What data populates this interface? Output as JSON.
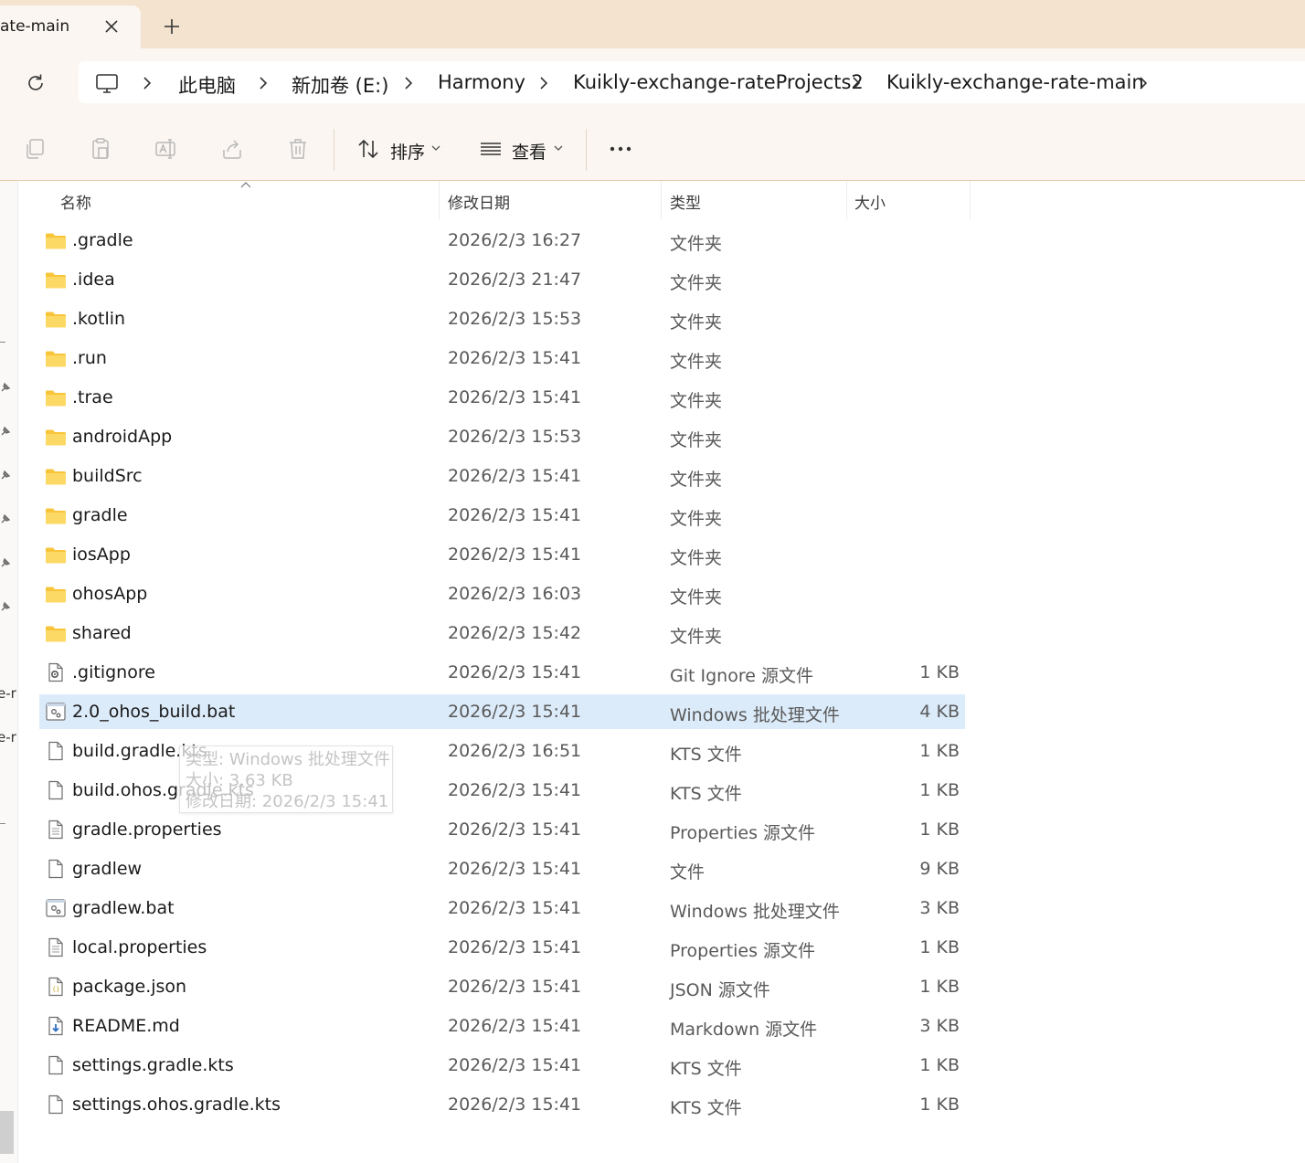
{
  "tab": {
    "title": "ate-main"
  },
  "breadcrumb": [
    "此电脑",
    "新加卷 (E:)",
    "Harmony",
    "Kuikly-exchange-rateProjects2",
    "Kuikly-exchange-rate-main"
  ],
  "toolbar": {
    "sort_label": "排序",
    "view_label": "查看",
    "icons": [
      "copy-icon",
      "paste-icon",
      "rename-icon",
      "share-icon",
      "delete-icon",
      "sort-icon",
      "view-icon",
      "more-icon"
    ]
  },
  "left_pane": {
    "truncated": [
      "e-r",
      "e-r"
    ]
  },
  "columns": {
    "name": "名称",
    "date": "修改日期",
    "type": "类型",
    "size": "大小"
  },
  "files": [
    {
      "name": ".gradle",
      "date": "2026/2/3 16:27",
      "type": "文件夹",
      "size": "",
      "icon": "folder"
    },
    {
      "name": ".idea",
      "date": "2026/2/3 21:47",
      "type": "文件夹",
      "size": "",
      "icon": "folder"
    },
    {
      "name": ".kotlin",
      "date": "2026/2/3 15:53",
      "type": "文件夹",
      "size": "",
      "icon": "folder"
    },
    {
      "name": ".run",
      "date": "2026/2/3 15:41",
      "type": "文件夹",
      "size": "",
      "icon": "folder"
    },
    {
      "name": ".trae",
      "date": "2026/2/3 15:41",
      "type": "文件夹",
      "size": "",
      "icon": "folder"
    },
    {
      "name": "androidApp",
      "date": "2026/2/3 15:53",
      "type": "文件夹",
      "size": "",
      "icon": "folder"
    },
    {
      "name": "buildSrc",
      "date": "2026/2/3 15:41",
      "type": "文件夹",
      "size": "",
      "icon": "folder"
    },
    {
      "name": "gradle",
      "date": "2026/2/3 15:41",
      "type": "文件夹",
      "size": "",
      "icon": "folder"
    },
    {
      "name": "iosApp",
      "date": "2026/2/3 15:41",
      "type": "文件夹",
      "size": "",
      "icon": "folder"
    },
    {
      "name": "ohosApp",
      "date": "2026/2/3 16:03",
      "type": "文件夹",
      "size": "",
      "icon": "folder"
    },
    {
      "name": "shared",
      "date": "2026/2/3 15:42",
      "type": "文件夹",
      "size": "",
      "icon": "folder"
    },
    {
      "name": ".gitignore",
      "date": "2026/2/3 15:41",
      "type": "Git Ignore 源文件",
      "size": "1 KB",
      "icon": "config"
    },
    {
      "name": "2.0_ohos_build.bat",
      "date": "2026/2/3 15:41",
      "type": "Windows 批处理文件",
      "size": "4 KB",
      "icon": "batch",
      "selected": true
    },
    {
      "name": "build.gradle.kts",
      "date": "2026/2/3 16:51",
      "type": "KTS 文件",
      "size": "1 KB",
      "icon": "file"
    },
    {
      "name": "build.ohos.gradle.kts",
      "date": "2026/2/3 15:41",
      "type": "KTS 文件",
      "size": "1 KB",
      "icon": "file"
    },
    {
      "name": "gradle.properties",
      "date": "2026/2/3 15:41",
      "type": "Properties 源文件",
      "size": "1 KB",
      "icon": "text"
    },
    {
      "name": "gradlew",
      "date": "2026/2/3 15:41",
      "type": "文件",
      "size": "9 KB",
      "icon": "file"
    },
    {
      "name": "gradlew.bat",
      "date": "2026/2/3 15:41",
      "type": "Windows 批处理文件",
      "size": "3 KB",
      "icon": "batch"
    },
    {
      "name": "local.properties",
      "date": "2026/2/3 15:41",
      "type": "Properties 源文件",
      "size": "1 KB",
      "icon": "text"
    },
    {
      "name": "package.json",
      "date": "2026/2/3 15:41",
      "type": "JSON 源文件",
      "size": "1 KB",
      "icon": "json"
    },
    {
      "name": "README.md",
      "date": "2026/2/3 15:41",
      "type": "Markdown 源文件",
      "size": "3 KB",
      "icon": "markdown"
    },
    {
      "name": "settings.gradle.kts",
      "date": "2026/2/3 15:41",
      "type": "KTS 文件",
      "size": "1 KB",
      "icon": "file"
    },
    {
      "name": "settings.ohos.gradle.kts",
      "date": "2026/2/3 15:41",
      "type": "KTS 文件",
      "size": "1 KB",
      "icon": "file"
    }
  ],
  "tooltip": {
    "type_line": "类型: Windows 批处理文件",
    "size_line": "大小: 3.63 KB",
    "date_line": "修改日期: 2026/2/3 15:41"
  },
  "colors": {
    "tab_strip": "#f3e3cf",
    "chrome": "#fbf6f1",
    "folder": "#f8c53a",
    "selection": "#dcebfa"
  }
}
